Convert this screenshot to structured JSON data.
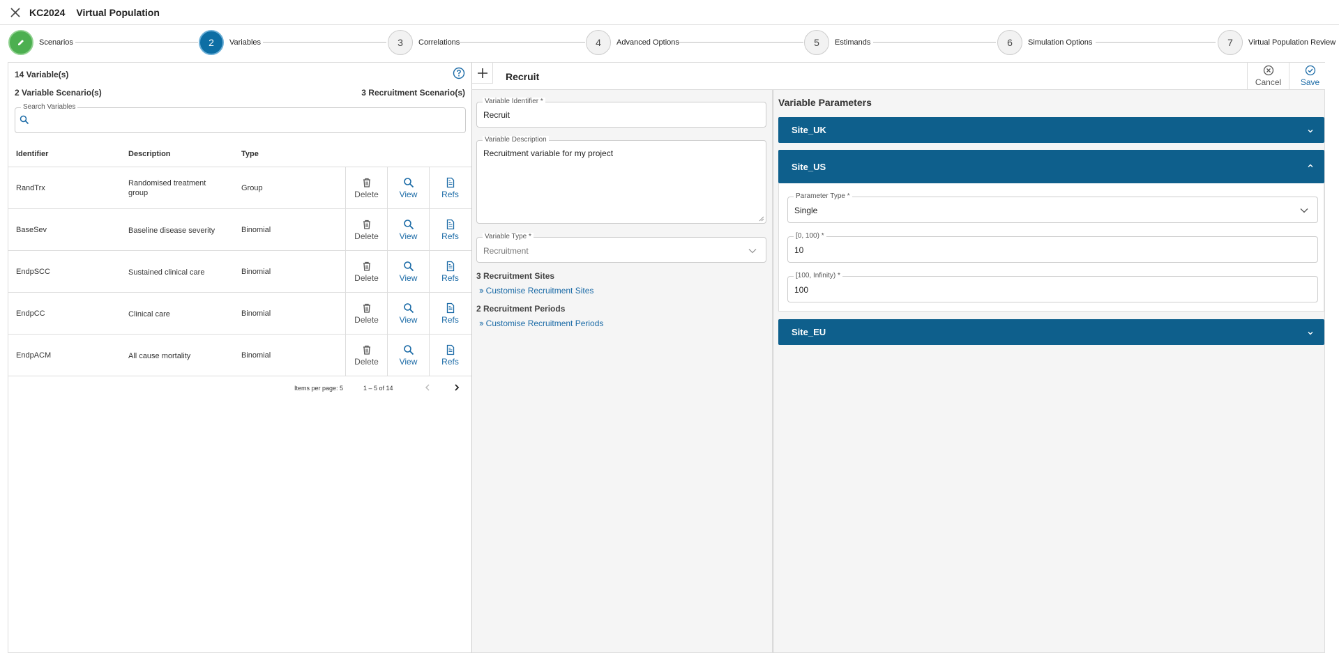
{
  "header": {
    "project": "KC2024",
    "app": "Virtual Population"
  },
  "stepper": {
    "steps": [
      {
        "num": "",
        "label": "Scenarios"
      },
      {
        "num": "2",
        "label": "Variables"
      },
      {
        "num": "3",
        "label": "Correlations"
      },
      {
        "num": "4",
        "label": "Advanced Options"
      },
      {
        "num": "5",
        "label": "Estimands"
      },
      {
        "num": "6",
        "label": "Simulation Options"
      },
      {
        "num": "7",
        "label": "Virtual Population Review"
      }
    ]
  },
  "left": {
    "count_label": "14 Variable(s)",
    "variable_scenarios": "2 Variable Scenario(s)",
    "recruitment_scenarios": "3 Recruitment Scenario(s)",
    "search_label": "Search Variables",
    "search_value": "",
    "columns": {
      "identifier": "Identifier",
      "description": "Description",
      "type": "Type"
    },
    "rows": [
      {
        "id": "RandTrx",
        "desc": "Randomised treatment group",
        "type": "Group"
      },
      {
        "id": "BaseSev",
        "desc": "Baseline disease severity",
        "type": "Binomial"
      },
      {
        "id": "EndpSCC",
        "desc": "Sustained clinical care",
        "type": "Binomial"
      },
      {
        "id": "EndpCC",
        "desc": "Clinical care",
        "type": "Binomial"
      },
      {
        "id": "EndpACM",
        "desc": "All cause mortality",
        "type": "Binomial"
      }
    ],
    "actions": {
      "delete": "Delete",
      "view": "View",
      "refs": "Refs"
    },
    "pager": {
      "items_per_page": "Items per page: 5",
      "range": "1 – 5 of 14"
    }
  },
  "detail": {
    "title": "Recruit",
    "cancel": "Cancel",
    "save": "Save",
    "identifier_label": "Variable Identifier *",
    "identifier_value": "Recruit",
    "description_label": "Variable Description",
    "description_value": "Recruitment variable for my project",
    "type_label": "Variable Type *",
    "type_value": "Recruitment",
    "sites_label": "3 Recruitment Sites",
    "sites_link": "Customise Recruitment Sites",
    "periods_label": "2 Recruitment Periods",
    "periods_link": "Customise Recruitment Periods"
  },
  "params": {
    "title": "Variable Parameters",
    "sites": [
      {
        "name": "Site_UK",
        "expanded": false
      },
      {
        "name": "Site_US",
        "expanded": true
      },
      {
        "name": "Site_EU",
        "expanded": false
      }
    ],
    "param_type_label": "Parameter Type *",
    "param_type_value": "Single",
    "range1_label": "[0, 100) *",
    "range1_value": "10",
    "range2_label": "[100, Infinity) *",
    "range2_value": "100"
  },
  "colors": {
    "accent": "#0e5f8c",
    "link": "#1a6aa6",
    "done": "#4caf50"
  }
}
